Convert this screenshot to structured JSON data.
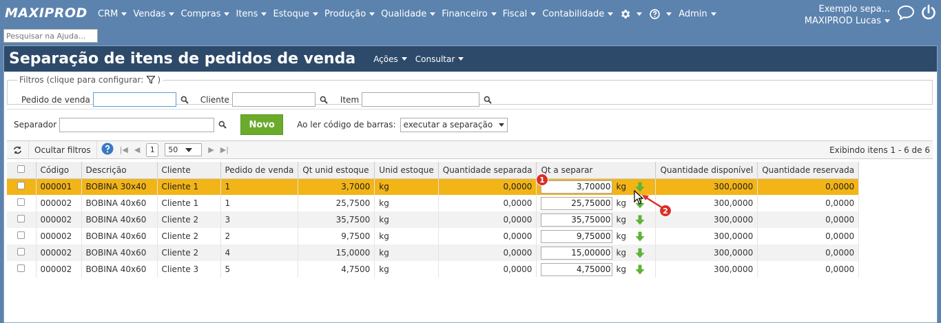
{
  "brand": "MAXIPROD",
  "nav": [
    "CRM",
    "Vendas",
    "Compras",
    "Itens",
    "Estoque",
    "Produção",
    "Qualidade",
    "Financeiro",
    "Fiscal",
    "Contabilidade"
  ],
  "nav_extra": {
    "admin": "Admin"
  },
  "user": {
    "company": "Exemplo sepa...",
    "name": "MAXIPROD Lucas"
  },
  "help_search": {
    "placeholder": "Pesquisar na Ajuda..."
  },
  "page": {
    "title": "Separação de itens de pedidos de venda",
    "menu_acoes": "Ações",
    "menu_consultar": "Consultar"
  },
  "filters": {
    "legend": "Filtros (clique para configurar:",
    "legend_end": ")",
    "pedido_label": "Pedido de venda",
    "cliente_label": "Cliente",
    "item_label": "Item"
  },
  "separator": {
    "label": "Separador",
    "novo": "Novo",
    "barcode_label": "Ao ler código de barras:",
    "barcode_value": "executar a separação"
  },
  "toolbar": {
    "hide_filters": "Ocultar filtros",
    "page": "1",
    "page_size": "50",
    "showing": "Exibindo itens 1 - 6 de 6"
  },
  "table": {
    "headers": [
      "Código",
      "Descrição",
      "Cliente",
      "Pedido de venda",
      "Qt unid estoque",
      "Unid estoque",
      "Quantidade separada",
      "Qt a separar",
      "Quantidade disponível",
      "Quantidade reservada"
    ],
    "rows": [
      {
        "codigo": "000001",
        "descricao": "BOBINA 30x40",
        "cliente": "Cliente 1",
        "pedido": "1",
        "qt_unid": "3,7000",
        "unid": "kg",
        "qt_sep": "0,0000",
        "qt_a_sep": "3,70000",
        "unit": "kg",
        "disp": "300,0000",
        "res": "0,0000"
      },
      {
        "codigo": "000002",
        "descricao": "BOBINA 40x60",
        "cliente": "Cliente 1",
        "pedido": "1",
        "qt_unid": "25,7500",
        "unid": "kg",
        "qt_sep": "0,0000",
        "qt_a_sep": "25,75000",
        "unit": "kg",
        "disp": "300,0000",
        "res": "0,0000"
      },
      {
        "codigo": "000002",
        "descricao": "BOBINA 40x60",
        "cliente": "Cliente 2",
        "pedido": "3",
        "qt_unid": "35,7500",
        "unid": "kg",
        "qt_sep": "0,0000",
        "qt_a_sep": "35,75000",
        "unit": "kg",
        "disp": "300,0000",
        "res": "0,0000"
      },
      {
        "codigo": "000002",
        "descricao": "BOBINA 40x60",
        "cliente": "Cliente 2",
        "pedido": "2",
        "qt_unid": "9,7500",
        "unid": "kg",
        "qt_sep": "0,0000",
        "qt_a_sep": "9,75000",
        "unit": "kg",
        "disp": "300,0000",
        "res": "0,0000"
      },
      {
        "codigo": "000002",
        "descricao": "BOBINA 40x60",
        "cliente": "Cliente 2",
        "pedido": "4",
        "qt_unid": "15,0000",
        "unid": "kg",
        "qt_sep": "0,0000",
        "qt_a_sep": "15,00000",
        "unit": "kg",
        "disp": "300,0000",
        "res": "0,0000"
      },
      {
        "codigo": "000002",
        "descricao": "BOBINA 40x60",
        "cliente": "Cliente 3",
        "pedido": "5",
        "qt_unid": "4,7500",
        "unid": "kg",
        "qt_sep": "0,0000",
        "qt_a_sep": "4,75000",
        "unit": "kg",
        "disp": "300,0000",
        "res": "0,0000"
      }
    ]
  },
  "annotations": {
    "badge1": "1",
    "badge2": "2"
  },
  "colors": {
    "topbar": "#5b83ae",
    "header": "#2e4a6a",
    "selected_row": "#f2b417",
    "novo_button": "#6aab2c",
    "badge": "#d93025"
  }
}
